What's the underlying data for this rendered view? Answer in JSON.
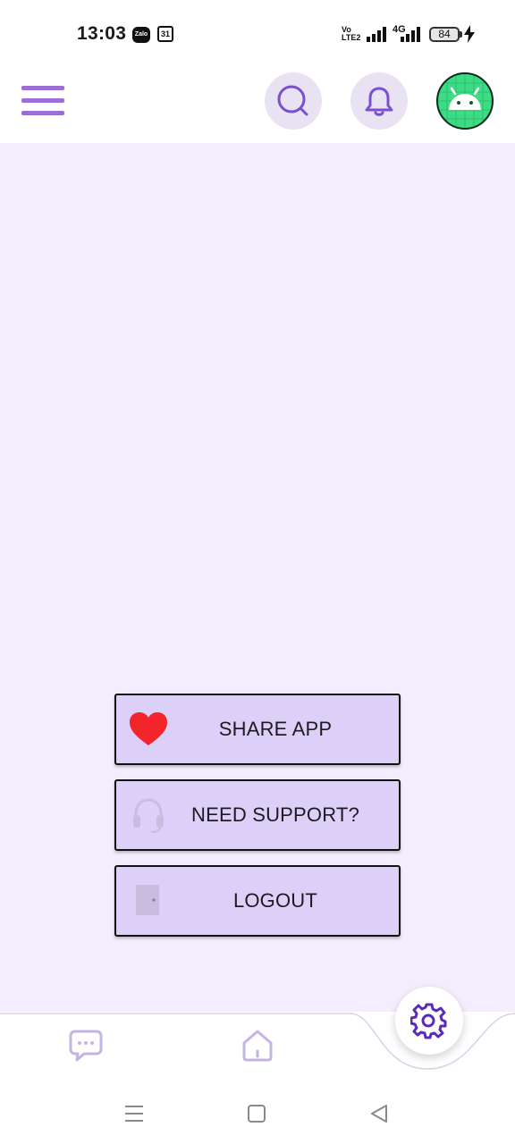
{
  "status_bar": {
    "time": "13:03",
    "calendar_day": "31",
    "zalo_label": "Zalo",
    "volte_label": "Vo LTE2",
    "network_type": "4G",
    "battery_level": "84"
  },
  "header": {
    "menu_icon": "hamburger-icon",
    "search_icon": "search-icon",
    "bell_icon": "bell-icon",
    "avatar_icon": "android-icon"
  },
  "actions": [
    {
      "label": "SHARE APP",
      "icon": "heart-icon",
      "icon_color": "#f2262a"
    },
    {
      "label": "NEED SUPPORT?",
      "icon": "headset-icon",
      "icon_color": "#c9bddf"
    },
    {
      "label": "LOGOUT",
      "icon": "door-icon",
      "icon_color": "#c9bddf"
    }
  ],
  "bottom_nav": {
    "items": [
      "chat-icon",
      "home-icon",
      "settings-icon"
    ],
    "active": "settings-icon"
  },
  "colors": {
    "accent": "#7b4fd0",
    "background": "#f3edfd",
    "button_fill": "#dcd0f8",
    "avatar": "#3ddc84"
  }
}
